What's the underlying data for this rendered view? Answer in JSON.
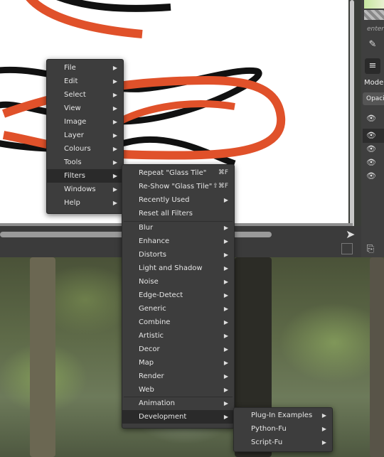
{
  "main_menu": {
    "items": [
      "File",
      "Edit",
      "Select",
      "View",
      "Image",
      "Layer",
      "Colours",
      "Tools",
      "Filters",
      "Windows",
      "Help"
    ],
    "highlighted": "Filters"
  },
  "filters_menu": {
    "top": [
      {
        "label": "Repeat \"Glass Tile\"",
        "accel": "⌘F"
      },
      {
        "label": "Re-Show \"Glass Tile\"",
        "accel": "⇧⌘F"
      },
      {
        "label": "Recently Used",
        "accel": ""
      },
      {
        "label": "Reset all Filters",
        "accel": ""
      }
    ],
    "groups": [
      "Blur",
      "Enhance",
      "Distorts",
      "Light and Shadow",
      "Noise",
      "Edge-Detect",
      "Generic",
      "Combine",
      "Artistic",
      "Decor",
      "Map",
      "Render",
      "Web"
    ],
    "bottom": [
      "Animation",
      "Development"
    ],
    "highlighted": "Development"
  },
  "development_menu": {
    "items": [
      "Plug-In Examples",
      "Python-Fu",
      "Script-Fu"
    ]
  },
  "dock": {
    "search_placeholder": "enter",
    "mode_label": "Mode",
    "opacity_label": "Opaci"
  },
  "colors": {
    "menu_bg": "#3d3d3d",
    "highlight": "#2a2a2a",
    "stroke_red": "#e0512a",
    "stroke_black": "#111111"
  }
}
